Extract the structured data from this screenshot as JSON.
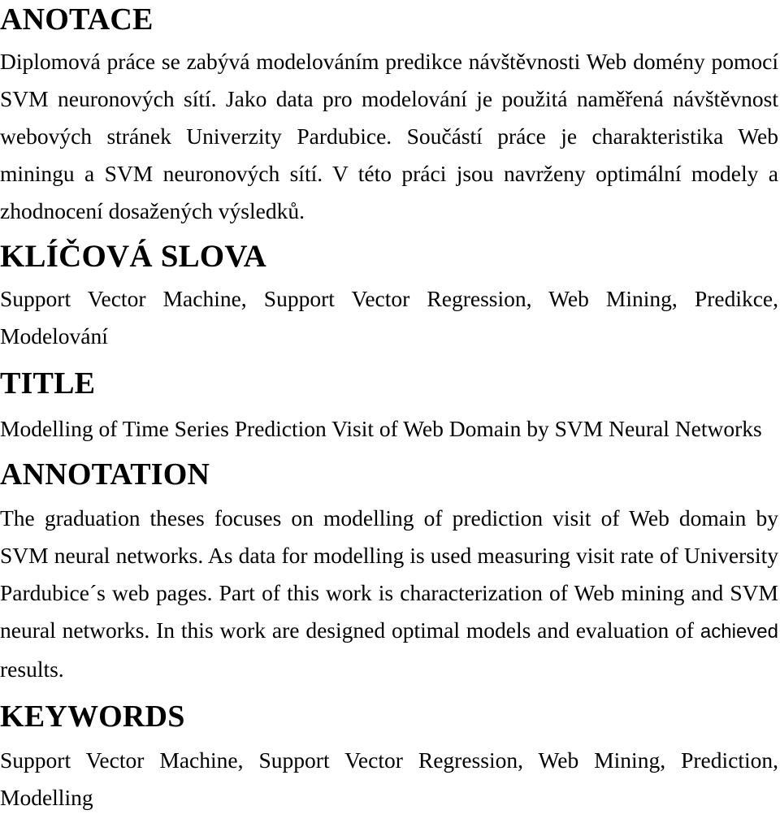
{
  "document": {
    "language": "cs-en",
    "text_color": "#000000",
    "background_color": "#ffffff"
  },
  "sections": {
    "anotace": {
      "heading": "ANOTACE",
      "body": "Diplomová práce se zabývá modelováním predikce návštěvnosti Web domény pomocí SVM neuronových sítí. Jako data pro modelování je použitá naměřená návštěvnost webových stránek Univerzity Pardubice. Součástí práce je charakteristika Web miningu a SVM neuronových sítí. V této práci jsou navrženy optimální modely a zhodnocení dosažených výsledků."
    },
    "klicova_slova": {
      "heading": "KLÍČOVÁ SLOVA",
      "body": "Support Vector Machine, Support Vector Regression, Web Mining, Predikce, Modelování"
    },
    "title": {
      "heading": "TITLE",
      "body": "Modelling of Time Series Prediction Visit of Web Domain by SVM Neural Networks"
    },
    "annotation": {
      "heading": "ANNOTATION",
      "body_part1": "The graduation theses focuses on modelling of prediction visit of Web domain by SVM neural networks. As data for modelling is used measuring visit rate of University Pardubice´s web pages. Part of this work is characterization of Web mining and SVM neural networks. In this work are designed optimal models and evaluation of ",
      "body_emphasis": "achieved",
      "body_part2": " results."
    },
    "keywords": {
      "heading": "KEYWORDS",
      "body": "Support Vector Machine, Support Vector Regression, Web Mining, Prediction, Modelling"
    }
  }
}
